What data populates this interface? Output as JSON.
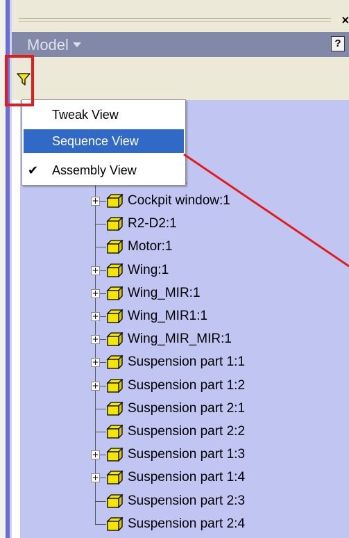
{
  "panel": {
    "title": "Model",
    "help_label": "?",
    "close_label": "×"
  },
  "context_menu": {
    "items": [
      {
        "label": "Tweak View",
        "checked": false,
        "selected": false
      },
      {
        "label": "Sequence View",
        "checked": false,
        "selected": true
      },
      {
        "label": "Assembly View",
        "checked": true,
        "selected": false
      }
    ]
  },
  "tree": {
    "partial_labels": [
      "m",
      "1"
    ],
    "items": [
      {
        "label": "Cockpit window:1",
        "expandable": true,
        "icon": "part-icon"
      },
      {
        "label": "R2-D2:1",
        "expandable": false,
        "icon": "part-icon"
      },
      {
        "label": "Motor:1",
        "expandable": false,
        "icon": "part-icon"
      },
      {
        "label": "Wing:1",
        "expandable": true,
        "icon": "part-icon"
      },
      {
        "label": "Wing_MIR:1",
        "expandable": true,
        "icon": "part-icon"
      },
      {
        "label": "Wing_MIR1:1",
        "expandable": true,
        "icon": "part-icon"
      },
      {
        "label": "Wing_MIR_MIR:1",
        "expandable": true,
        "icon": "part-icon"
      },
      {
        "label": "Suspension part 1:1",
        "expandable": true,
        "icon": "part-icon"
      },
      {
        "label": "Suspension part 1:2",
        "expandable": true,
        "icon": "part-icon"
      },
      {
        "label": "Suspension part 2:1",
        "expandable": false,
        "icon": "part-icon"
      },
      {
        "label": "Suspension part 2:2",
        "expandable": false,
        "icon": "part-icon"
      },
      {
        "label": "Suspension part 1:3",
        "expandable": true,
        "icon": "part-icon"
      },
      {
        "label": "Suspension part 1:4",
        "expandable": true,
        "icon": "part-icon"
      },
      {
        "label": "Suspension part 2:3",
        "expandable": false,
        "icon": "part-icon"
      },
      {
        "label": "Suspension part 2:4",
        "expandable": false,
        "icon": "part-icon"
      }
    ]
  },
  "colors": {
    "tree_background": "#c1c5f2",
    "title_bar": "#8289a8",
    "menu_highlight": "#3169c6",
    "annotation_red": "#e41b1b",
    "part_icon_yellow": "#f5e600"
  },
  "icons": {
    "filter": "filter-icon",
    "expander": "plus-icon",
    "help": "help-icon",
    "close": "close-icon"
  }
}
